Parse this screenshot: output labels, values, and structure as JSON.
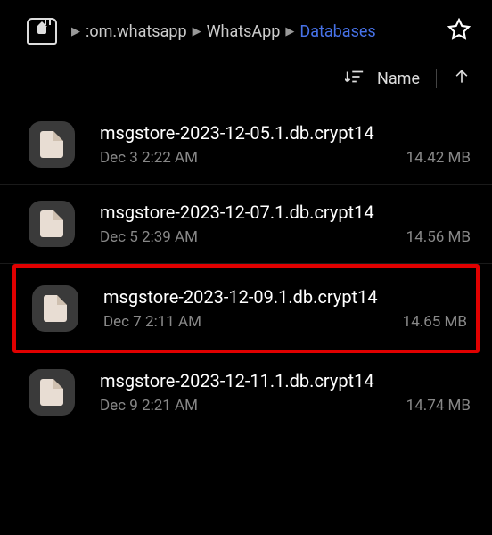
{
  "breadcrumb": {
    "items": [
      {
        "label": ":om.whatsapp"
      },
      {
        "label": "WhatsApp"
      },
      {
        "label": "Databases",
        "active": true
      }
    ]
  },
  "sort": {
    "label": "Name"
  },
  "files": [
    {
      "name": "msgstore-2023-12-05.1.db.crypt14",
      "date": "Dec 3 2:22 AM",
      "size": "14.42 MB",
      "highlighted": false
    },
    {
      "name": "msgstore-2023-12-07.1.db.crypt14",
      "date": "Dec 5 2:39 AM",
      "size": "14.56 MB",
      "highlighted": false
    },
    {
      "name": "msgstore-2023-12-09.1.db.crypt14",
      "date": "Dec 7 2:11 AM",
      "size": "14.65 MB",
      "highlighted": true
    },
    {
      "name": "msgstore-2023-12-11.1.db.crypt14",
      "date": "Dec 9 2:21 AM",
      "size": "14.74 MB",
      "highlighted": false
    }
  ]
}
